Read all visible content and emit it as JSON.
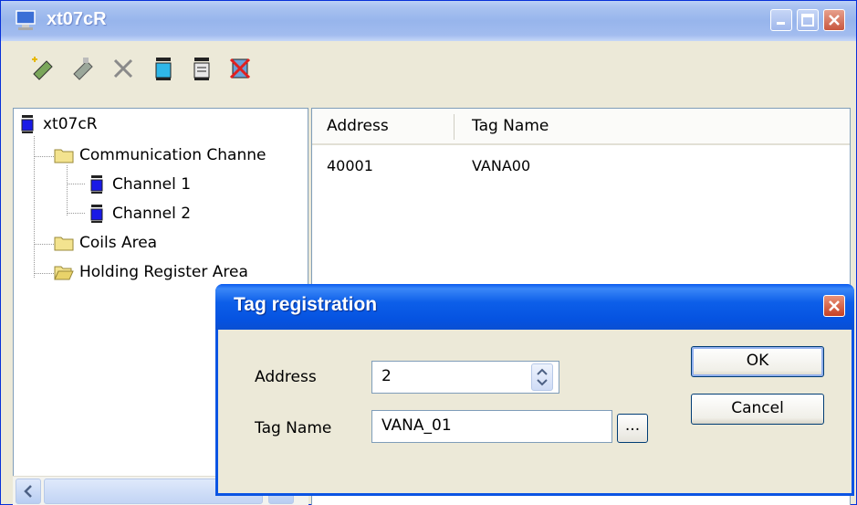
{
  "window": {
    "title": "xt07cR"
  },
  "toolbar": {
    "tools": [
      "new-tag-icon",
      "edit-tag-icon",
      "delete-icon",
      "channel-icon",
      "channel-alt-icon",
      "remove-channel-icon"
    ]
  },
  "tree": {
    "root": "xt07cR",
    "items": [
      {
        "label": "Communication Channe",
        "icon": "folder-icon"
      },
      {
        "label": "Channel 1",
        "icon": "channel-icon"
      },
      {
        "label": "Channel 2",
        "icon": "channel-icon"
      },
      {
        "label": "Coils Area",
        "icon": "folder-icon"
      },
      {
        "label": "Holding Register Area",
        "icon": "folder-open-icon"
      }
    ]
  },
  "list": {
    "columns": [
      "Address",
      "Tag Name"
    ],
    "rows": [
      {
        "address": "40001",
        "tag_name": "VANA00"
      }
    ]
  },
  "dialog": {
    "title": "Tag registration",
    "address_label": "Address",
    "address_value": "2",
    "tag_name_label": "Tag Name",
    "tag_name_value": "VANA_01",
    "browse_label": "...",
    "ok_label": "OK",
    "cancel_label": "Cancel"
  },
  "colors": {
    "accent": "#0b54e3",
    "titlebar": "#97b5ec"
  }
}
